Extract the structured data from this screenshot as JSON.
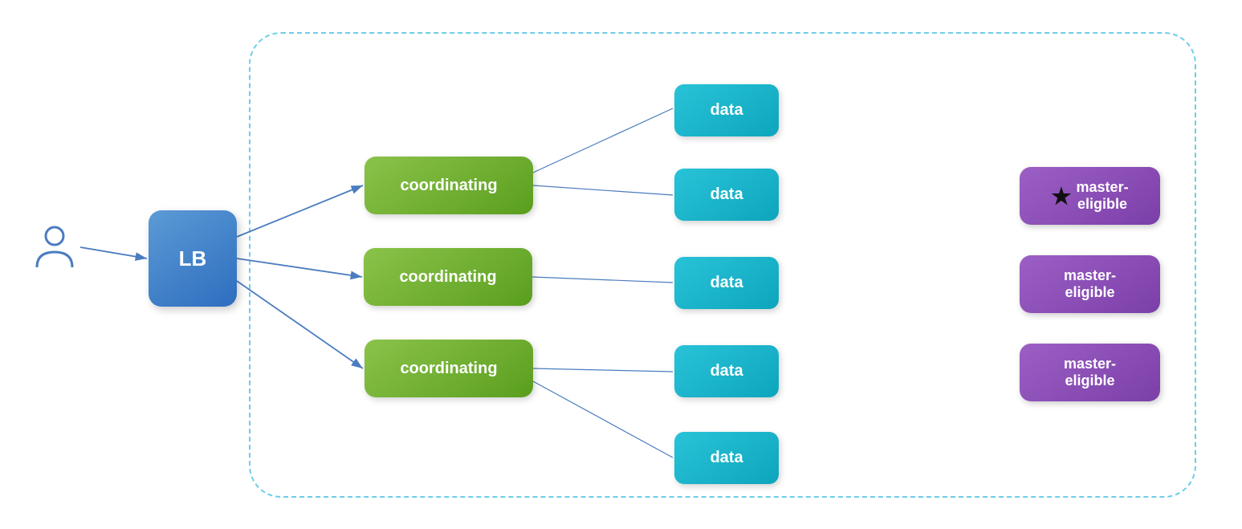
{
  "lb": {
    "label": "LB"
  },
  "coord_nodes": [
    {
      "label": "coordinating"
    },
    {
      "label": "coordinating"
    },
    {
      "label": "coordinating"
    }
  ],
  "data_nodes": [
    {
      "label": "data"
    },
    {
      "label": "data"
    },
    {
      "label": "data"
    },
    {
      "label": "data"
    },
    {
      "label": "data"
    }
  ],
  "master_nodes": [
    {
      "label": "master-\neligible",
      "star": true
    },
    {
      "label": "master-\neligible",
      "star": false
    },
    {
      "label": "master-\neligible",
      "star": false
    }
  ],
  "colors": {
    "lb_gradient_start": "#5b9bd5",
    "lb_gradient_end": "#2e6dbf",
    "coord_gradient_start": "#8bc34a",
    "coord_gradient_end": "#5a9e1e",
    "data_gradient_start": "#29c3d8",
    "data_gradient_end": "#0da5bc",
    "master_gradient_start": "#9c5fc5",
    "master_gradient_end": "#7b3fa8",
    "dashed_border": "#6ecde8",
    "arrow_stroke": "#4a7cbf"
  }
}
